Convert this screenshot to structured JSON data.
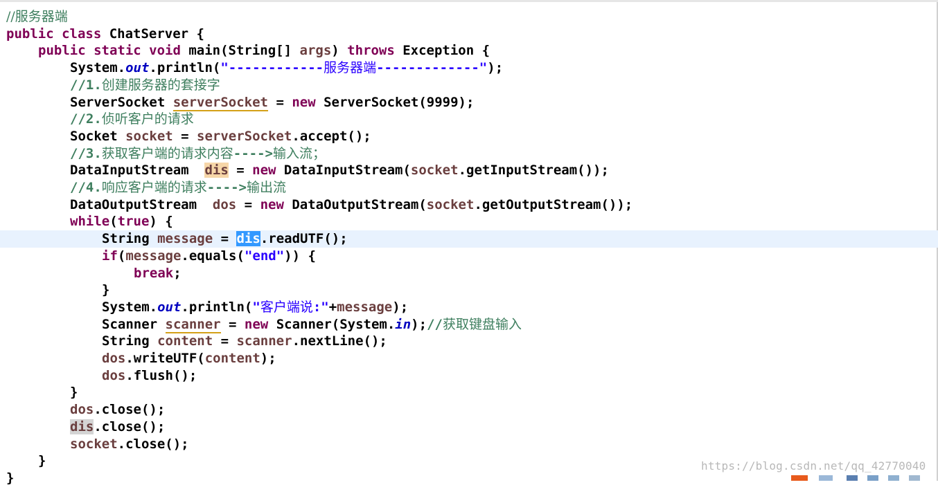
{
  "editor": {
    "lines": [
      [
        {
          "t": "//服务器端",
          "c": "cmt cjk"
        }
      ],
      [
        {
          "t": "public class ",
          "c": "kw"
        },
        {
          "t": "ChatServer {",
          "c": "typ"
        }
      ],
      [
        {
          "t": "public static void ",
          "c": "kw"
        },
        {
          "t": "main(String[] ",
          "c": "typ"
        },
        {
          "t": "args",
          "c": "var"
        },
        {
          "t": ") ",
          "c": "typ"
        },
        {
          "t": "throws ",
          "c": "kw"
        },
        {
          "t": "Exception {",
          "c": "typ"
        }
      ],
      [
        {
          "t": "System.",
          "c": "typ"
        },
        {
          "t": "out",
          "c": "fld"
        },
        {
          "t": ".println(",
          "c": "typ"
        },
        {
          "t": "\"------------",
          "c": "str"
        },
        {
          "t": "服务器端",
          "c": "str cjk"
        },
        {
          "t": "-------------\"",
          "c": "str"
        },
        {
          "t": ");",
          "c": "typ"
        }
      ],
      [
        {
          "t": "//1.",
          "c": "cmt"
        },
        {
          "t": "创建服务器的套接字",
          "c": "cmt cjk"
        }
      ],
      [
        {
          "t": "ServerSocket ",
          "c": "typ"
        },
        {
          "t": "serverSocket",
          "c": "var warn"
        },
        {
          "t": " = ",
          "c": "typ"
        },
        {
          "t": "new ",
          "c": "kw"
        },
        {
          "t": "ServerSocket(9999);",
          "c": "typ"
        }
      ],
      [
        {
          "t": "//2.",
          "c": "cmt"
        },
        {
          "t": "侦听客户的请求",
          "c": "cmt cjk"
        }
      ],
      [
        {
          "t": "Socket ",
          "c": "typ"
        },
        {
          "t": "socket",
          "c": "var"
        },
        {
          "t": " = ",
          "c": "typ"
        },
        {
          "t": "serverSocket",
          "c": "var"
        },
        {
          "t": ".accept();",
          "c": "typ"
        }
      ],
      [
        {
          "t": "//3.",
          "c": "cmt"
        },
        {
          "t": "获取客户端的请求内容",
          "c": "cmt cjk"
        },
        {
          "t": "---->",
          "c": "cmt"
        },
        {
          "t": "输入流；",
          "c": "cmt cjk"
        }
      ],
      [
        {
          "t": "DataInputStream  ",
          "c": "typ"
        },
        {
          "t": "dis",
          "c": "var occ"
        },
        {
          "t": " = ",
          "c": "typ"
        },
        {
          "t": "new ",
          "c": "kw"
        },
        {
          "t": "DataInputStream(",
          "c": "typ"
        },
        {
          "t": "socket",
          "c": "var"
        },
        {
          "t": ".getInputStream());",
          "c": "typ"
        }
      ],
      [
        {
          "t": "//4.",
          "c": "cmt"
        },
        {
          "t": "响应客户端的请求",
          "c": "cmt cjk"
        },
        {
          "t": "---->",
          "c": "cmt"
        },
        {
          "t": "输出流",
          "c": "cmt cjk"
        }
      ],
      [
        {
          "t": "DataOutputStream  ",
          "c": "typ"
        },
        {
          "t": "dos",
          "c": "var"
        },
        {
          "t": " = ",
          "c": "typ"
        },
        {
          "t": "new ",
          "c": "kw"
        },
        {
          "t": "DataOutputStream(",
          "c": "typ"
        },
        {
          "t": "socket",
          "c": "var"
        },
        {
          "t": ".getOutputStream());",
          "c": "typ"
        }
      ],
      [
        {
          "t": "while",
          "c": "kw"
        },
        {
          "t": "(",
          "c": "typ"
        },
        {
          "t": "true",
          "c": "kw"
        },
        {
          "t": ") {",
          "c": "typ"
        }
      ],
      [
        {
          "t": "String ",
          "c": "typ"
        },
        {
          "t": "message",
          "c": "var"
        },
        {
          "t": " = ",
          "c": "typ"
        },
        {
          "t": "dis",
          "c": "sel"
        },
        {
          "t": ".readUTF();",
          "c": "typ"
        }
      ],
      [
        {
          "t": "if",
          "c": "kw"
        },
        {
          "t": "(",
          "c": "typ"
        },
        {
          "t": "message",
          "c": "var"
        },
        {
          "t": ".equals(",
          "c": "typ"
        },
        {
          "t": "\"end\"",
          "c": "str"
        },
        {
          "t": ")) {",
          "c": "typ"
        }
      ],
      [
        {
          "t": "break",
          "c": "kw"
        },
        {
          "t": ";",
          "c": "typ"
        }
      ],
      [
        {
          "t": "}",
          "c": "typ"
        }
      ],
      [
        {
          "t": "System.",
          "c": "typ"
        },
        {
          "t": "out",
          "c": "fld"
        },
        {
          "t": ".println(",
          "c": "typ"
        },
        {
          "t": "\"",
          "c": "str"
        },
        {
          "t": "客户端说",
          "c": "str cjk"
        },
        {
          "t": ":\"",
          "c": "str"
        },
        {
          "t": "+",
          "c": "typ"
        },
        {
          "t": "message",
          "c": "var"
        },
        {
          "t": ");",
          "c": "typ"
        }
      ],
      [
        {
          "t": "Scanner ",
          "c": "typ"
        },
        {
          "t": "scanner",
          "c": "var warn"
        },
        {
          "t": " = ",
          "c": "typ"
        },
        {
          "t": "new ",
          "c": "kw"
        },
        {
          "t": "Scanner(System.",
          "c": "typ"
        },
        {
          "t": "in",
          "c": "fld"
        },
        {
          "t": ");",
          "c": "typ"
        },
        {
          "t": "//",
          "c": "cmt"
        },
        {
          "t": "获取键盘输入",
          "c": "cmt cjk"
        }
      ],
      [
        {
          "t": "String ",
          "c": "typ"
        },
        {
          "t": "content",
          "c": "var"
        },
        {
          "t": " = ",
          "c": "typ"
        },
        {
          "t": "scanner",
          "c": "var"
        },
        {
          "t": ".nextLine();",
          "c": "typ"
        }
      ],
      [
        {
          "t": "dos",
          "c": "var"
        },
        {
          "t": ".writeUTF(",
          "c": "typ"
        },
        {
          "t": "content",
          "c": "var"
        },
        {
          "t": ");",
          "c": "typ"
        }
      ],
      [
        {
          "t": "dos",
          "c": "var"
        },
        {
          "t": ".flush();",
          "c": "typ"
        }
      ],
      [
        {
          "t": "}",
          "c": "typ"
        }
      ],
      [
        {
          "t": "dos",
          "c": "var"
        },
        {
          "t": ".close();",
          "c": "typ"
        }
      ],
      [
        {
          "t": "dis",
          "c": "var occ2"
        },
        {
          "t": ".close();",
          "c": "typ"
        }
      ],
      [
        {
          "t": "socket",
          "c": "var"
        },
        {
          "t": ".close();",
          "c": "typ"
        }
      ],
      [
        {
          "t": "}",
          "c": "typ"
        }
      ],
      [
        {
          "t": "}",
          "c": "typ"
        }
      ]
    ],
    "current_line": 13
  },
  "watermark": {
    "text": "https://blog.csdn.net/qq_42770040"
  }
}
